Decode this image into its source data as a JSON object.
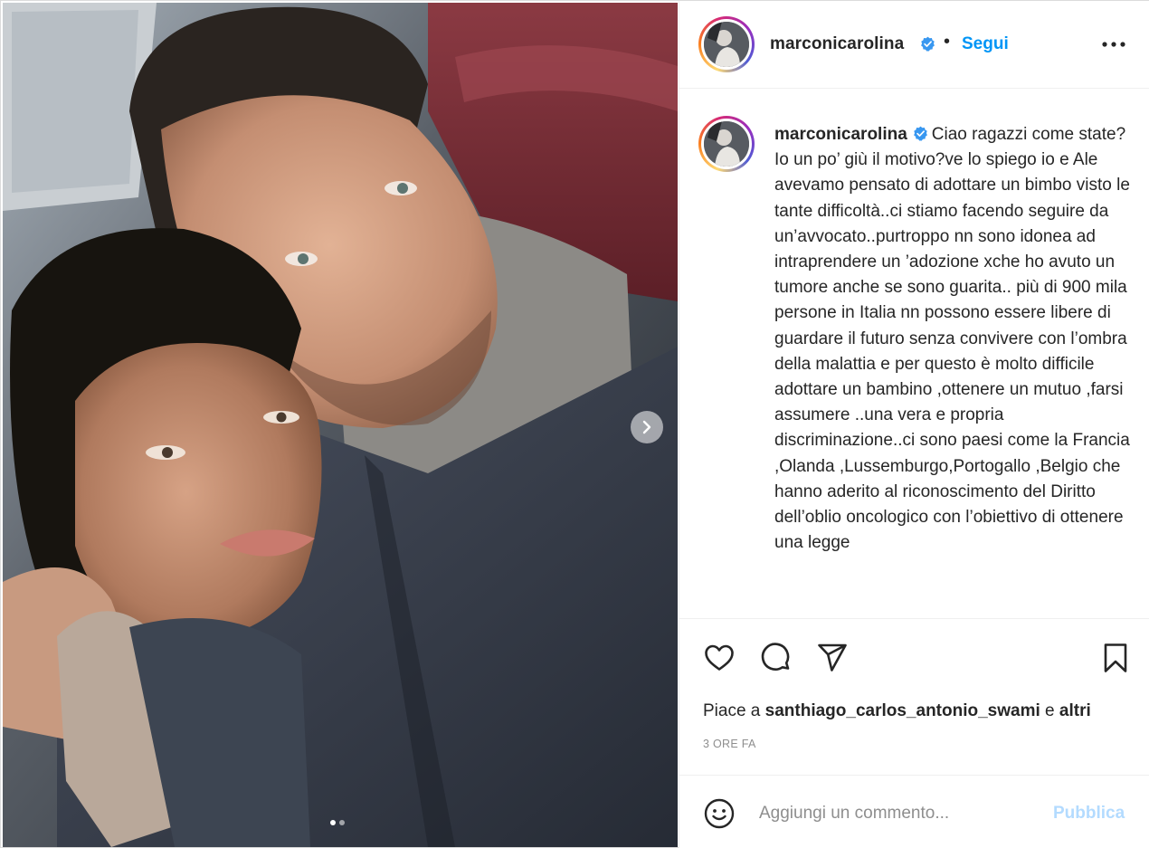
{
  "post": {
    "media": {
      "image_label": "selfie-couple-in-car",
      "carousel_count": 2,
      "carousel_active_index": 0,
      "next_icon": "chevron-right-icon"
    },
    "header": {
      "username": "marconicarolina",
      "verified_icon": "verified-badge-icon",
      "separator": "•",
      "follow_label": "Segui",
      "more_icon": "more-horizontal-icon"
    },
    "caption": {
      "username": "marconicarolina",
      "text": "Ciao ragazzi come state? Io un po’ giù il motivo?ve lo spiego io e Ale avevamo pensato di adottare un bimbo visto le tante difficoltà..ci stiamo facendo seguire da un’avvocato..purtroppo nn sono idonea ad intraprendere un ’adozione xche ho avuto un tumore anche se sono guarita.. più di 900 mila persone in Italia nn possono essere libere di guardare il futuro senza convivere con l’ombra della malattia e per questo è molto difficile adottare un bambino ,ottenere un mutuo ,farsi assumere ..una vera e propria discriminazione..ci sono paesi come la Francia ,Olanda ,Lussemburgo,Portogallo ,Belgio che hanno aderito al riconoscimento del Diritto dell’oblio oncologico con l’obiettivo di ottenere una legge"
    },
    "actions": {
      "like_icon": "heart-icon",
      "comment_icon": "comment-icon",
      "share_icon": "paper-plane-icon",
      "save_icon": "bookmark-icon"
    },
    "likes": {
      "prefix": "Piace a",
      "user": "santhiago_carlos_antonio_swami",
      "conjunction": "e",
      "others": "altri"
    },
    "timestamp": "3 ORE FA",
    "comment_box": {
      "emoji_icon": "emoji-smiley-icon",
      "placeholder": "Aggiungi un commento...",
      "publish_label": "Pubblica"
    },
    "colors": {
      "link_blue": "#0095f6",
      "publish_disabled": "#b3dbff",
      "verified_blue": "#3897f0",
      "text": "#262626",
      "muted": "#8e8e8e"
    }
  }
}
